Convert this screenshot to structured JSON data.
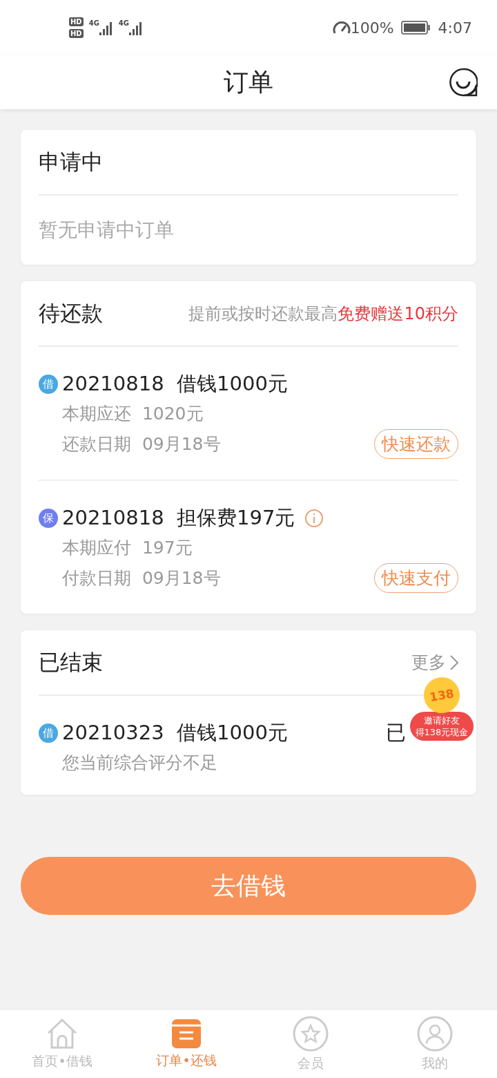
{
  "status_bar": {
    "sim_labels": [
      "HD",
      "HD"
    ],
    "network": [
      "4G",
      "4G"
    ],
    "battery": "100%",
    "time": "4:07"
  },
  "header": {
    "title": "订单"
  },
  "applying": {
    "title": "申请中",
    "empty": "暂无申请中订单"
  },
  "pending": {
    "title": "待还款",
    "note": "提前或按时还款最高**免费赠送10积分**",
    "items": [
      {
        "tag": "借",
        "color": "#4aa8e0",
        "date": "20210818",
        "name": "借钱1000元",
        "info": false,
        "line1_label": "本期应还",
        "line1_value": "1020元",
        "line2_label": "还款日期",
        "line2_value": "09月18号",
        "action": "快速还款"
      },
      {
        "tag": "保",
        "color": "#6f7ef0",
        "date": "20210818",
        "name": "担保费197元",
        "info": true,
        "line1_label": "本期应付",
        "line1_value": "197元",
        "line2_label": "付款日期",
        "line2_value": "09月18号",
        "action": "快速支付"
      }
    ]
  },
  "finished": {
    "title": "已结束",
    "more": "更多",
    "items": [
      {
        "tag": "借",
        "color": "#4aa8e0",
        "date": "20210323",
        "name": "借钱1000元",
        "status": "已",
        "note": "您当前综合评分不足"
      }
    ]
  },
  "promo": {
    "coin": "138",
    "lines": [
      "邀请好友",
      "得138元现金"
    ]
  },
  "borrow_button": "去借钱",
  "tabs": [
    {
      "label": "首页•借钱",
      "kind": "home",
      "selected": false
    },
    {
      "label": "订单•还钱",
      "kind": "list",
      "selected": true
    },
    {
      "label": "会员",
      "kind": "star",
      "selected": false
    },
    {
      "label": "我的",
      "kind": "user",
      "selected": false
    }
  ]
}
